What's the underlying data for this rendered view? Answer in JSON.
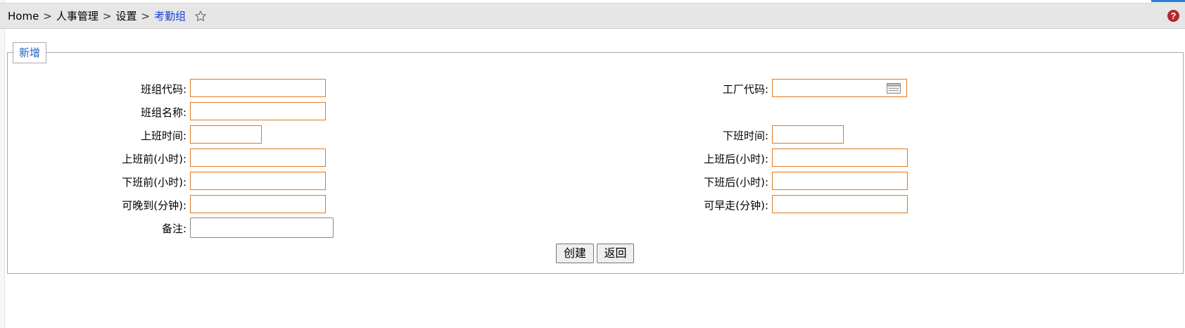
{
  "breadcrumb": {
    "items": [
      "Home",
      "人事管理",
      "设置"
    ],
    "current": "考勤组",
    "separator": ">"
  },
  "section": {
    "legend": "新增"
  },
  "form": {
    "left": [
      {
        "key": "banzu_code",
        "label": "班组代码:",
        "value": ""
      },
      {
        "key": "banzu_name",
        "label": "班组名称:",
        "value": ""
      },
      {
        "key": "work_start",
        "label": "上班时间:",
        "value": ""
      },
      {
        "key": "before_work",
        "label": "上班前(小时):",
        "value": ""
      },
      {
        "key": "before_off",
        "label": "下班前(小时):",
        "value": ""
      },
      {
        "key": "late_allowed",
        "label": "可晚到(分钟):",
        "value": ""
      },
      {
        "key": "remark",
        "label": "备注:",
        "value": ""
      }
    ],
    "right": [
      {
        "key": "factory_code",
        "label": "工厂代码:",
        "value": ""
      },
      {
        "key": "work_end",
        "label": "下班时间:",
        "value": ""
      },
      {
        "key": "after_work",
        "label": "上班后(小时):",
        "value": ""
      },
      {
        "key": "after_off",
        "label": "下班后(小时):",
        "value": ""
      },
      {
        "key": "early_leave",
        "label": "可早走(分钟):",
        "value": ""
      }
    ]
  },
  "buttons": {
    "create": "创建",
    "back": "返回"
  },
  "icons": {
    "favorite": "star-outline-icon",
    "help": "help-icon",
    "calendar": "calendar-icon"
  },
  "colors": {
    "input_border": "#e07a1f",
    "legend_text": "#1e63c5",
    "breadcrumb_current": "#1a3fd6",
    "help_bg": "#b3262d"
  }
}
